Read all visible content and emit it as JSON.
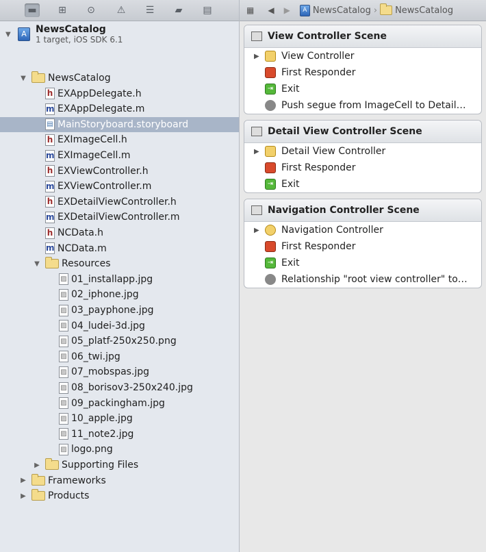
{
  "navigator": {
    "project": {
      "name": "NewsCatalog",
      "subtitle": "1 target, iOS SDK 6.1"
    },
    "items": [
      {
        "label": "NewsCatalog",
        "kind": "folder",
        "indent": 1,
        "disclosure": "open"
      },
      {
        "label": "EXAppDelegate.h",
        "kind": "h",
        "indent": 2
      },
      {
        "label": "EXAppDelegate.m",
        "kind": "m",
        "indent": 2
      },
      {
        "label": "MainStoryboard.storyboard",
        "kind": "sb",
        "indent": 2,
        "selected": true
      },
      {
        "label": "EXImageCell.h",
        "kind": "h",
        "indent": 2
      },
      {
        "label": "EXImageCell.m",
        "kind": "m",
        "indent": 2
      },
      {
        "label": "EXViewController.h",
        "kind": "h",
        "indent": 2
      },
      {
        "label": "EXViewController.m",
        "kind": "m",
        "indent": 2
      },
      {
        "label": "EXDetailViewController.h",
        "kind": "h",
        "indent": 2
      },
      {
        "label": "EXDetailViewController.m",
        "kind": "m",
        "indent": 2
      },
      {
        "label": "NCData.h",
        "kind": "h",
        "indent": 2
      },
      {
        "label": "NCData.m",
        "kind": "m",
        "indent": 2
      },
      {
        "label": "Resources",
        "kind": "folder",
        "indent": 2,
        "disclosure": "open"
      },
      {
        "label": "01_installapp.jpg",
        "kind": "img",
        "indent": 3
      },
      {
        "label": "02_iphone.jpg",
        "kind": "img",
        "indent": 3
      },
      {
        "label": "03_payphone.jpg",
        "kind": "img",
        "indent": 3
      },
      {
        "label": "04_ludei-3d.jpg",
        "kind": "img",
        "indent": 3
      },
      {
        "label": "05_platf-250x250.png",
        "kind": "img",
        "indent": 3
      },
      {
        "label": "06_twi.jpg",
        "kind": "img",
        "indent": 3
      },
      {
        "label": "07_mobspas.jpg",
        "kind": "img",
        "indent": 3
      },
      {
        "label": "08_borisov3-250x240.jpg",
        "kind": "img",
        "indent": 3
      },
      {
        "label": "09_packingham.jpg",
        "kind": "img",
        "indent": 3
      },
      {
        "label": "10_apple.jpg",
        "kind": "img",
        "indent": 3
      },
      {
        "label": "11_note2.jpg",
        "kind": "img",
        "indent": 3
      },
      {
        "label": "logo.png",
        "kind": "img",
        "indent": 3
      },
      {
        "label": "Supporting Files",
        "kind": "folder",
        "indent": 2,
        "disclosure": "closed"
      },
      {
        "label": "Frameworks",
        "kind": "folder",
        "indent": 1,
        "disclosure": "closed"
      },
      {
        "label": "Products",
        "kind": "folder",
        "indent": 1,
        "disclosure": "closed"
      }
    ]
  },
  "jumpbar": {
    "crumb1": "NewsCatalog",
    "crumb2": "NewsCatalog"
  },
  "scenes": [
    {
      "title": "View Controller Scene",
      "rows": [
        {
          "label": "View Controller",
          "icon": "vc",
          "disclosure": true
        },
        {
          "label": "First Responder",
          "icon": "fr"
        },
        {
          "label": "Exit",
          "icon": "exit"
        },
        {
          "label": "Push segue from ImageCell to Detail…",
          "icon": "seg"
        }
      ]
    },
    {
      "title": "Detail View Controller Scene",
      "rows": [
        {
          "label": "Detail View Controller",
          "icon": "vc",
          "disclosure": true
        },
        {
          "label": "First Responder",
          "icon": "fr"
        },
        {
          "label": "Exit",
          "icon": "exit"
        }
      ]
    },
    {
      "title": "Navigation Controller Scene",
      "rows": [
        {
          "label": "Navigation Controller",
          "icon": "nav",
          "disclosure": true
        },
        {
          "label": "First Responder",
          "icon": "fr"
        },
        {
          "label": "Exit",
          "icon": "exit"
        },
        {
          "label": "Relationship \"root view controller\" to…",
          "icon": "seg"
        }
      ]
    }
  ]
}
